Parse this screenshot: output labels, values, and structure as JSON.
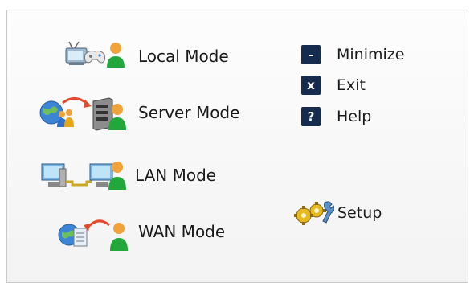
{
  "modes": [
    {
      "label": "Local Mode"
    },
    {
      "label": "Server Mode"
    },
    {
      "label": "LAN Mode"
    },
    {
      "label": "WAN Mode"
    }
  ],
  "commands": {
    "minimize": {
      "label": "Minimize",
      "key": "–"
    },
    "exit": {
      "label": "Exit",
      "key": "x"
    },
    "help": {
      "label": "Help",
      "key": "?"
    }
  },
  "setup": {
    "label": "Setup"
  },
  "colors": {
    "key_bg": "#152c4e",
    "person_green": "#22a83a",
    "person_skin": "#f2a23a",
    "globe_blue": "#3c84d4",
    "arrow_red": "#e64a2e"
  }
}
